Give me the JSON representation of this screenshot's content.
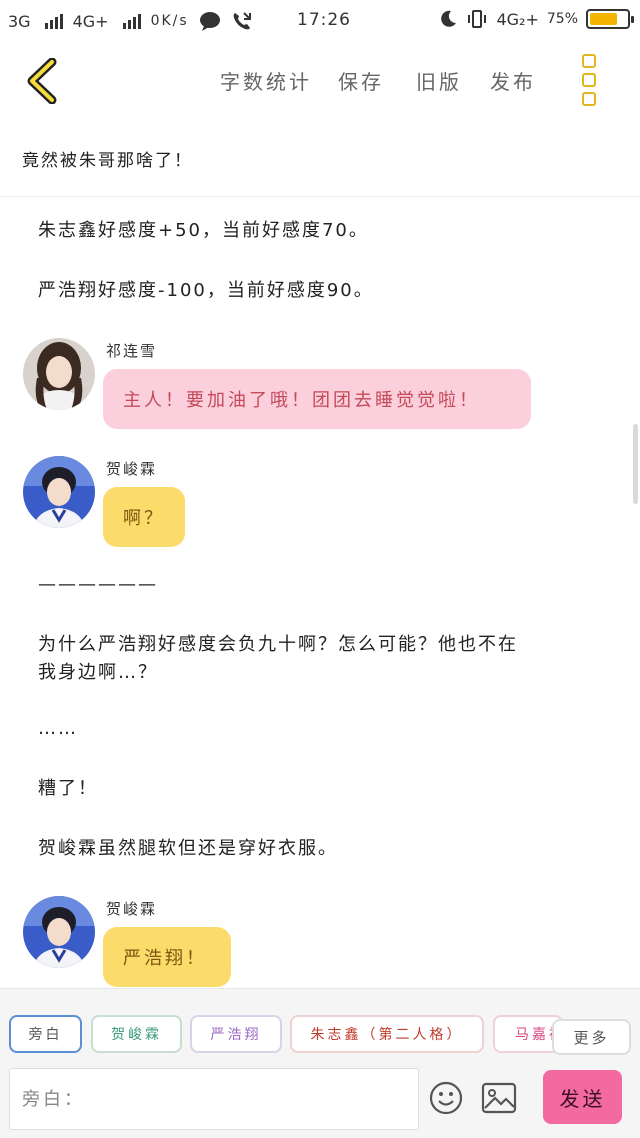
{
  "status_bar": {
    "net1": "3G",
    "net2": "4G+",
    "speed": "0K/s",
    "time": "17:26",
    "net3": "4G₂+",
    "battery_text": "75%",
    "battery_level": 0.75
  },
  "toolbar": {
    "word_count": "字数统计",
    "save": "保存",
    "old_version": "旧版",
    "publish": "发布"
  },
  "chapter_title": "竟然被朱哥那啥了！",
  "content": {
    "line1": "朱志鑫好感度+50，当前好感度70。",
    "line2": "严浩翔好感度-100，当前好感度90。",
    "msg1_speaker": "祁连雪",
    "msg1_text": "主人！要加油了哦！团团去睡觉觉啦！",
    "msg2_speaker": "贺峻霖",
    "msg2_text": "啊？",
    "dashes": "——————",
    "para1_line1": "为什么严浩翔好感度会负九十啊？怎么可能？他也不在",
    "para1_line2": "我身边啊…？",
    "ellipsis": "……",
    "oops": "糟了！",
    "para2": "贺峻霖虽然腿软但还是穿好衣服。",
    "msg3_speaker": "贺峻霖",
    "msg3_text": "严浩翔！"
  },
  "roles": {
    "items": [
      "旁白",
      "贺峻霖",
      "严浩翔",
      "朱志鑫（第二人格）",
      "马嘉祺"
    ],
    "more": "更多"
  },
  "input": {
    "placeholder": "旁白：",
    "send": "发送"
  },
  "colors": {
    "accent_yellow": "#e2b51b",
    "bubble_pink": "#fbd0dc",
    "bubble_yellow": "#fbdb6a",
    "send_pink": "#f26aa0"
  }
}
